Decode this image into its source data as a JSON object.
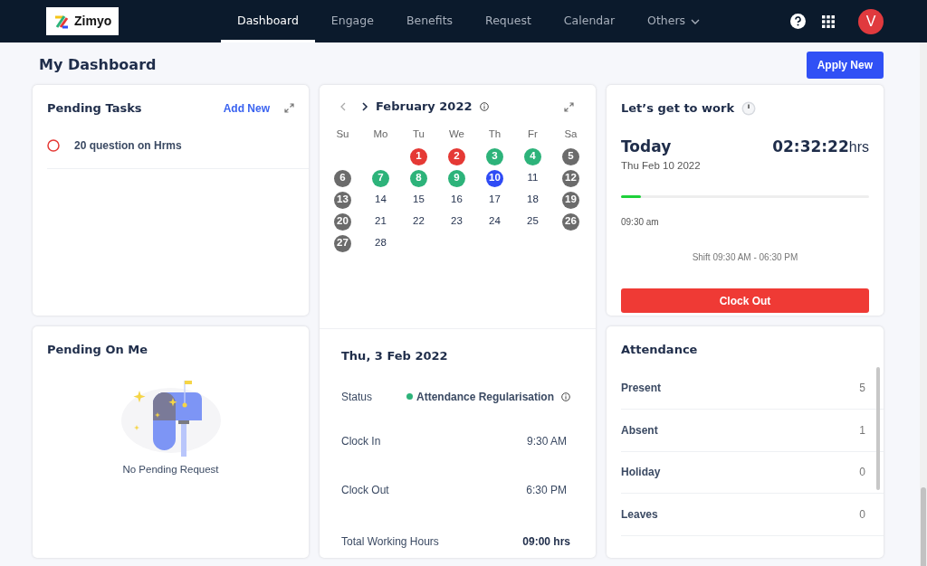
{
  "nav": {
    "logo": "Zimyo",
    "avatar": "V",
    "items": [
      {
        "label": "Dashboard",
        "selected": true
      },
      {
        "label": "Engage",
        "selected": false
      },
      {
        "label": "Benefits",
        "selected": false
      },
      {
        "label": "Request",
        "selected": false
      },
      {
        "label": "Calendar",
        "selected": false
      },
      {
        "label": "Others",
        "selected": false,
        "dropdown": true
      }
    ]
  },
  "page": {
    "title": "My Dashboard",
    "action": "Apply New"
  },
  "pending_tasks": {
    "title": "Pending Tasks",
    "action": "Add New",
    "tasks": [
      {
        "label": "20 question on Hrms",
        "done": false
      }
    ]
  },
  "calendar": {
    "month": "February 2022",
    "weekdays": [
      "Su",
      "Mo",
      "Tu",
      "We",
      "Th",
      "Fr",
      "Sa"
    ],
    "weeks": [
      [
        {
          "day": "1",
          "color": "#e53935"
        },
        {
          "day": "2",
          "color": "#e53935"
        },
        {
          "day": "3",
          "color": "#2db37a"
        },
        {
          "day": "4",
          "color": "#2db37a"
        },
        {
          "day": "5",
          "color": "#6b6b6b"
        }
      ],
      [
        {
          "day": "6",
          "color": "#6b6b6b"
        },
        {
          "day": "7",
          "color": "#2db37a"
        },
        {
          "day": "8",
          "color": "#2db37a"
        },
        {
          "day": "9",
          "color": "#2db37a"
        },
        {
          "day": "10",
          "color": "#2f4bf5"
        },
        {
          "day": "11"
        },
        {
          "day": "12",
          "color": "#6b6b6b"
        }
      ],
      [
        {
          "day": "13",
          "color": "#6b6b6b"
        },
        {
          "day": "14"
        },
        {
          "day": "15"
        },
        {
          "day": "16"
        },
        {
          "day": "17"
        },
        {
          "day": "18"
        },
        {
          "day": "19",
          "color": "#6b6b6b"
        }
      ],
      [
        {
          "day": "20",
          "color": "#6b6b6b"
        },
        {
          "day": "21"
        },
        {
          "day": "22"
        },
        {
          "day": "23"
        },
        {
          "day": "24"
        },
        {
          "day": "25"
        },
        {
          "day": "26",
          "color": "#6b6b6b"
        }
      ],
      [
        {
          "day": "27",
          "color": "#6b6b6b"
        },
        {
          "day": "28"
        }
      ]
    ],
    "detail": {
      "date": "Thu, 3 Feb 2022",
      "rows": [
        {
          "label": "Status",
          "value": "Attendance Regularisation",
          "kind": "status",
          "color": "#2db37a"
        },
        {
          "label": "Clock In",
          "value": "9:30 AM",
          "kind": "text"
        },
        {
          "label": "Clock Out",
          "value": "6:30 PM",
          "kind": "text"
        },
        {
          "label": "Total Working Hours",
          "value": "09:00 hrs",
          "kind": "bold"
        }
      ]
    }
  },
  "work": {
    "title": "Let’s get to work",
    "day": "Today",
    "date": "Thu Feb 10 2022",
    "timer": "02:32:22",
    "timer_unit": "hrs",
    "level": 0.08,
    "start": "09:30 am",
    "shift": "Shift 09:30 AM - 06:30 PM",
    "button": "Clock Out"
  },
  "pending_on_me": {
    "title": "Pending On Me",
    "empty": "No Pending Request"
  },
  "attendance": {
    "title": "Attendance",
    "rows": [
      {
        "label": "Present",
        "count": "5"
      },
      {
        "label": "Absent",
        "count": "1"
      },
      {
        "label": "Holiday",
        "count": "0"
      },
      {
        "label": "Leaves",
        "count": "0"
      }
    ]
  }
}
